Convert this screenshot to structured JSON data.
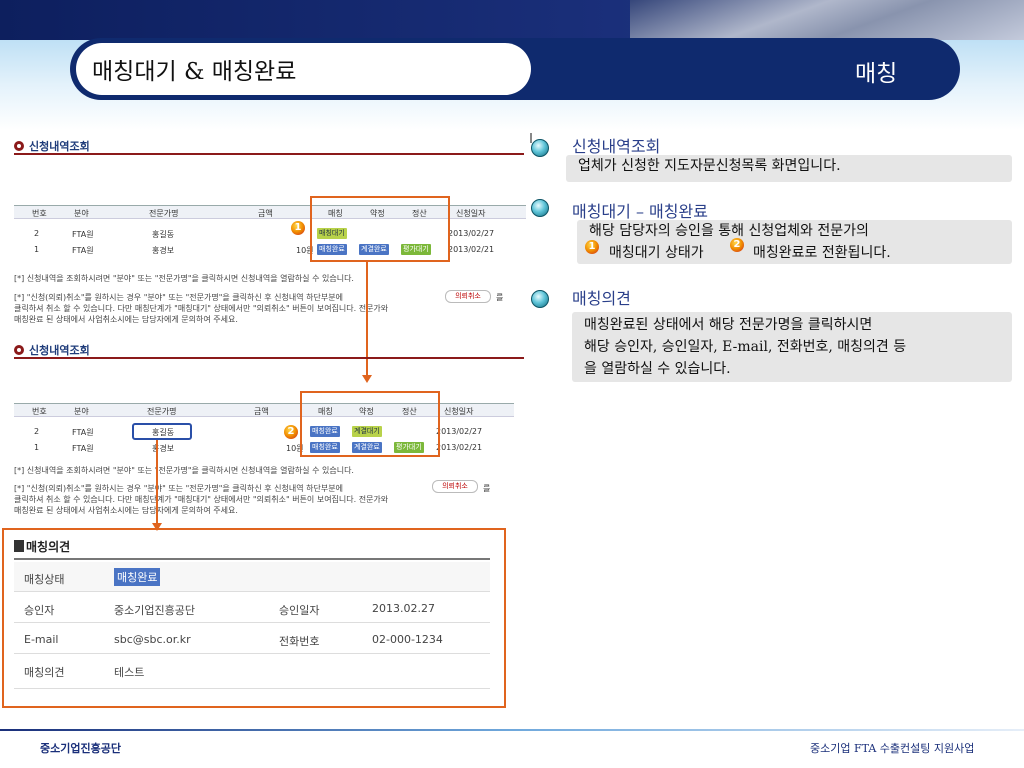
{
  "header": {
    "title": "매칭대기 & 매칭완료",
    "section": "매칭"
  },
  "screen1": {
    "title": "신청내역조회",
    "columns": [
      "번호",
      "분야",
      "전문가명",
      "금액",
      "매칭",
      "약정",
      "정산",
      "신청일자"
    ],
    "rows": [
      {
        "no": "2",
        "field": "FTA원",
        "name": "홍길동",
        "amount": "",
        "match": "매칭대기",
        "date": "2013/02/27"
      },
      {
        "no": "1",
        "field": "FTA원",
        "name": "홍경보",
        "amount": "10원",
        "match": "매칭완료",
        "contract": "계결완료",
        "settle": "평가대기",
        "date": "2013/02/21"
      }
    ],
    "note1": "[*] 신청내역을 조회하시려면 \"분야\" 또는 \"전문가명\"을 클릭하시면 신청내역을 열람하실 수 있습니다.",
    "note2": "[*] \"신청(의뢰)취소\"를 원하시는 경우 \"분야\" 또는 \"전문가명\"을 클릭하신 후 신청내역 하단부분에",
    "cancel_btn": "의뢰취소",
    "note2_tail": "를",
    "note3": "클릭하셔 취소 할 수 있습니다. 다만 매칭단계가 \"매칭대기\" 상태에서만 \"의뢰취소\" 버튼이 보여집니다. 전문가와",
    "note4": "매칭완료 된 상태에서 사업취소시에는 담당자에게 문의하여 주세요."
  },
  "screen2": {
    "title": "신청내역조회",
    "columns": [
      "번호",
      "분야",
      "전문가명",
      "금액",
      "매칭",
      "약정",
      "정산",
      "신청일자"
    ],
    "rows": [
      {
        "no": "2",
        "field": "FTA원",
        "name": "홍길동",
        "amount": "",
        "match": "매칭완료",
        "contract": "계결대기",
        "date": "2013/02/27"
      },
      {
        "no": "1",
        "field": "FTA원",
        "name": "홍경보",
        "amount": "10원",
        "match": "매칭완료",
        "contract": "계결완료",
        "settle": "평가대기",
        "date": "2013/02/21"
      }
    ],
    "note1": "[*] 신청내역을 조회하시려면 \"분야\" 또는 \"전문가명\"을 클릭하시면 신청내역을 열람하실 수 있습니다.",
    "note2": "[*] \"신청(의뢰)취소\"를 원하시는 경우 \"분야\" 또는 \"전문가명\"을 클릭하신 후 신청내역 하단부분에",
    "cancel_btn": "의뢰취소",
    "note2_tail": "를",
    "note3": "클릭하셔 취소 할 수 있습니다. 다만 매칭단계가 \"매칭대기\" 상태에서만 \"의뢰취소\" 버튼이 보여집니다. 전문가와",
    "note4": "매칭완료 된 상태에서 사업취소시에는 담당자에게 문의하여 주세요."
  },
  "detail": {
    "title": "매칭의견",
    "status_label": "매칭상태",
    "status_value": "매칭완료",
    "approver_label": "승인자",
    "approver_value": "중소기업진흥공단",
    "date_label": "승인일자",
    "date_value": "2013.02.27",
    "email_label": "E-mail",
    "email_value": "sbc@sbc.or.kr",
    "phone_label": "전화번호",
    "phone_value": "02-000-1234",
    "opinion_label": "매칭의견",
    "opinion_value": "테스트"
  },
  "markers": {
    "one": "1",
    "two": "2"
  },
  "right": [
    {
      "title": "신청내역조회",
      "lines": [
        "업체가 신청한 지도자문신청목록 화면입니다."
      ]
    },
    {
      "title": "매칭대기 – 매칭완료",
      "lines": [
        "해당 담당자의 승인을 통해 신청업체와 전문가의",
        "매칭대기 상태가",
        "매칭완료로 전환됩니다."
      ]
    },
    {
      "title": "매칭의견",
      "lines": [
        "매칭완료된 상태에서 해당 전문가명을 클릭하시면",
        "해당 승인자, 승인일자, E-mail, 전화번호, 매칭의견 등",
        "을 열람하실 수 있습니다."
      ]
    }
  ],
  "footer": {
    "left": "중소기업진흥공단",
    "right": "중소기업 FTA 수출컨설팅 지원사업"
  },
  "colors": {
    "navy": "#0f2a6e",
    "orange": "#e0641e",
    "accent": "#2a3f8a"
  }
}
